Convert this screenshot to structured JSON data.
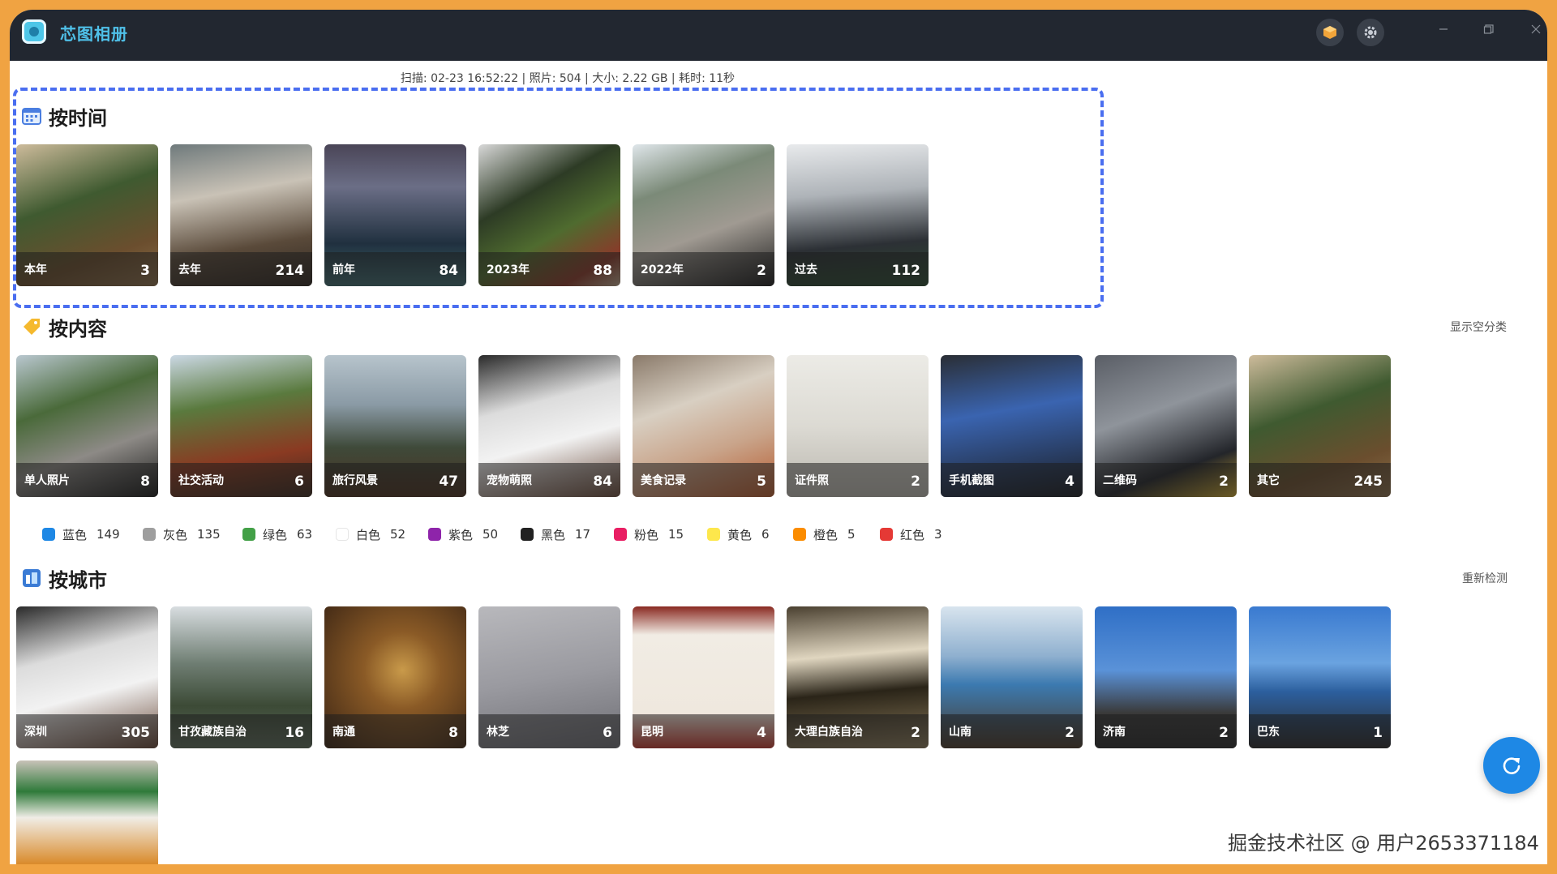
{
  "app": {
    "title": "芯图相册"
  },
  "scan_info": "扫描: 02-23 16:52:22 | 照片: 504 | 大小: 2.22 GB | 耗时: 11秒",
  "by_time": {
    "title": "按时间",
    "tiles": [
      {
        "label": "本年",
        "count": "3"
      },
      {
        "label": "去年",
        "count": "214"
      },
      {
        "label": "前年",
        "count": "84"
      },
      {
        "label": "2023年",
        "count": "88"
      },
      {
        "label": "2022年",
        "count": "2"
      },
      {
        "label": "过去",
        "count": "112"
      }
    ]
  },
  "by_content": {
    "title": "按内容",
    "side_link": "显示空分类",
    "tiles": [
      {
        "label": "单人照片",
        "count": "8"
      },
      {
        "label": "社交活动",
        "count": "6"
      },
      {
        "label": "旅行风景",
        "count": "47"
      },
      {
        "label": "宠物萌照",
        "count": "84"
      },
      {
        "label": "美食记录",
        "count": "5"
      },
      {
        "label": "证件照",
        "count": "2"
      },
      {
        "label": "手机截图",
        "count": "4"
      },
      {
        "label": "二维码",
        "count": "2"
      },
      {
        "label": "其它",
        "count": "245"
      }
    ],
    "colors": [
      {
        "label": "蓝色",
        "count": "149",
        "color": "#1e88e5"
      },
      {
        "label": "灰色",
        "count": "135",
        "color": "#9e9e9e"
      },
      {
        "label": "绿色",
        "count": "63",
        "color": "#43a047"
      },
      {
        "label": "白色",
        "count": "52",
        "color": "#ffffff"
      },
      {
        "label": "紫色",
        "count": "50",
        "color": "#8e24aa"
      },
      {
        "label": "黑色",
        "count": "17",
        "color": "#212121"
      },
      {
        "label": "粉色",
        "count": "15",
        "color": "#e91e63"
      },
      {
        "label": "黄色",
        "count": "6",
        "color": "#fde74c"
      },
      {
        "label": "橙色",
        "count": "5",
        "color": "#fb8c00"
      },
      {
        "label": "红色",
        "count": "3",
        "color": "#e53935"
      }
    ]
  },
  "by_city": {
    "title": "按城市",
    "side_link": "重新检测",
    "tiles": [
      {
        "label": "深圳",
        "count": "305"
      },
      {
        "label": "甘孜藏族自治",
        "count": "16"
      },
      {
        "label": "南通",
        "count": "8"
      },
      {
        "label": "林芝",
        "count": "6"
      },
      {
        "label": "昆明",
        "count": "4"
      },
      {
        "label": "大理白族自治",
        "count": "2"
      },
      {
        "label": "山南",
        "count": "2"
      },
      {
        "label": "济南",
        "count": "2"
      },
      {
        "label": "巴东",
        "count": "1"
      }
    ]
  },
  "watermark": "掘金技术社区 @ 用户2653371184"
}
